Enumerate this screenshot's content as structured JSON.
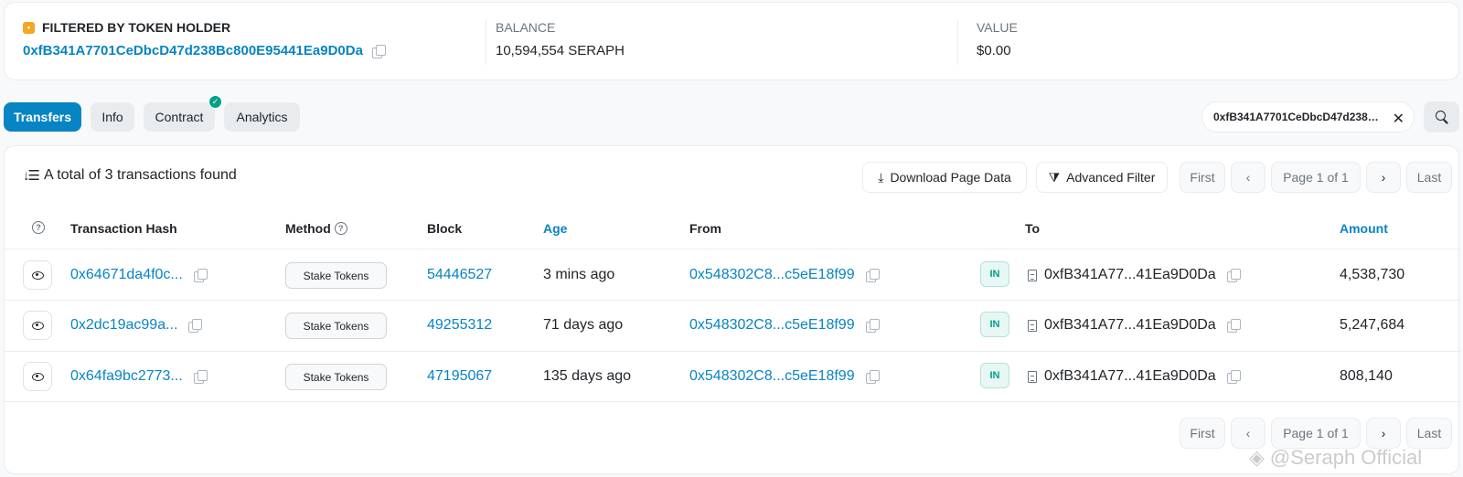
{
  "summary": {
    "holder_label": "FILTERED BY TOKEN HOLDER",
    "holder_address": "0xfB341A7701CeDbcD47d238Bc800E95441Ea9D0Da",
    "balance_label": "BALANCE",
    "balance_value": "10,594,554 SERAPH",
    "value_label": "VALUE",
    "value_value": "$0.00"
  },
  "tabs": [
    {
      "label": "Transfers",
      "active": true
    },
    {
      "label": "Info",
      "active": false
    },
    {
      "label": "Contract",
      "active": false,
      "verified": true
    },
    {
      "label": "Analytics",
      "active": false
    }
  ],
  "filter": {
    "chip_text": "0xfB341A7701CeDbcD47d238Bc800E95441Ea9D0Da",
    "close_glyph": "✕"
  },
  "toolbar": {
    "total_text": "A total of 3 transactions found",
    "download_label": "Download Page Data",
    "advanced_filter_label": "Advanced Filter"
  },
  "pagination": {
    "first": "First",
    "prev": "‹",
    "page_info": "Page 1 of 1",
    "next": "›",
    "last": "Last"
  },
  "columns": {
    "tx_hash": "Transaction Hash",
    "method": "Method",
    "block": "Block",
    "age": "Age",
    "from": "From",
    "to": "To",
    "amount": "Amount"
  },
  "rows": [
    {
      "hash": "0x64671da4f0c...",
      "method": "Stake Tokens",
      "block": "54446527",
      "age": "3 mins ago",
      "from": "0x548302C8...c5eE18f99",
      "direction": "IN",
      "to": "0xfB341A77...41Ea9D0Da",
      "amount": "4,538,730"
    },
    {
      "hash": "0x2dc19ac99a...",
      "method": "Stake Tokens",
      "block": "49255312",
      "age": "71 days ago",
      "from": "0x548302C8...c5eE18f99",
      "direction": "IN",
      "to": "0xfB341A77...41Ea9D0Da",
      "amount": "5,247,684"
    },
    {
      "hash": "0x64fa9bc2773...",
      "method": "Stake Tokens",
      "block": "47195067",
      "age": "135 days ago",
      "from": "0x548302C8...c5eE18f99",
      "direction": "IN",
      "to": "0xfB341A77...41Ea9D0Da",
      "amount": "808,140"
    }
  ],
  "watermark": "@Seraph Official",
  "colors": {
    "accent": "#0784c3",
    "success": "#00a186",
    "token_badge": "#f5a623"
  }
}
